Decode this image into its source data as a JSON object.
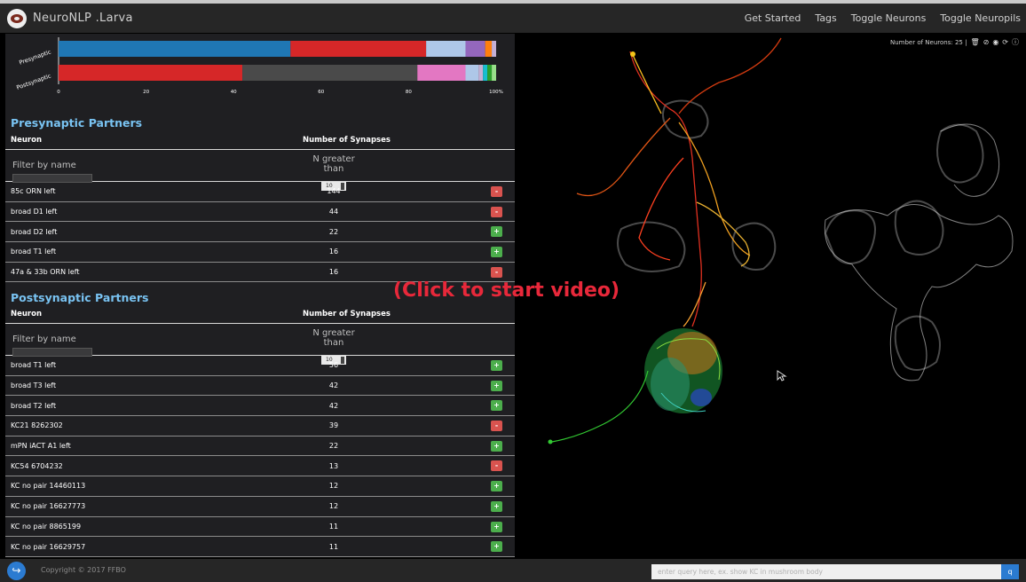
{
  "app": {
    "title": "NeuroNLP .Larva"
  },
  "nav": [
    {
      "label": "Get Started"
    },
    {
      "label": "Tags"
    },
    {
      "label": "Toggle Neurons"
    },
    {
      "label": "Toggle Neuropils"
    }
  ],
  "chart_data": {
    "type": "bar",
    "orientation": "horizontal-stacked",
    "categories": [
      "Presynaptic",
      "Postsynaptic"
    ],
    "x_ticks": [
      "0",
      "20",
      "40",
      "60",
      "80",
      "100%"
    ],
    "xlim": [
      0,
      100
    ],
    "series": [
      {
        "category": "Presynaptic",
        "segments": [
          {
            "value": 53,
            "color": "#1f77b4"
          },
          {
            "value": 31,
            "color": "#d62728"
          },
          {
            "value": 9,
            "color": "#aec7e8"
          },
          {
            "value": 4.5,
            "color": "#9467bd"
          },
          {
            "value": 1.5,
            "color": "#ff7f0e"
          },
          {
            "value": 1,
            "color": "#c5b0d5"
          }
        ]
      },
      {
        "category": "Postsynaptic",
        "segments": [
          {
            "value": 42,
            "color": "#d62728"
          },
          {
            "value": 40,
            "color": "#4a4a4a"
          },
          {
            "value": 11,
            "color": "#e377c2"
          },
          {
            "value": 3,
            "color": "#aec7e8"
          },
          {
            "value": 1,
            "color": "#c5b0d5"
          },
          {
            "value": 1,
            "color": "#17becf"
          },
          {
            "value": 1,
            "color": "#2ca02c"
          },
          {
            "value": 1,
            "color": "#98df8a"
          }
        ]
      }
    ]
  },
  "presynaptic": {
    "title": "Presynaptic Partners",
    "col_neuron": "Neuron",
    "col_synapses": "Number of Synapses",
    "filter_placeholder": "Filter by name",
    "n_greater_label": "N greater than",
    "n_greater_value": "10",
    "rows": [
      {
        "name": "85c ORN left",
        "count": "144",
        "action": "-"
      },
      {
        "name": "broad D1 left",
        "count": "44",
        "action": "-"
      },
      {
        "name": "broad D2 left",
        "count": "22",
        "action": "+"
      },
      {
        "name": "broad T1 left",
        "count": "16",
        "action": "+"
      },
      {
        "name": "47a & 33b ORN left",
        "count": "16",
        "action": "-"
      }
    ]
  },
  "postsynaptic": {
    "title": "Postsynaptic Partners",
    "col_neuron": "Neuron",
    "col_synapses": "Number of Synapses",
    "filter_placeholder": "Filter by name",
    "n_greater_label": "N greater than",
    "n_greater_value": "10",
    "rows": [
      {
        "name": "broad T1 left",
        "count": "56",
        "action": "+"
      },
      {
        "name": "broad T3 left",
        "count": "42",
        "action": "+"
      },
      {
        "name": "broad T2 left",
        "count": "42",
        "action": "+"
      },
      {
        "name": "KC21 8262302",
        "count": "39",
        "action": "-"
      },
      {
        "name": "mPN iACT A1 left",
        "count": "22",
        "action": "+"
      },
      {
        "name": "KC54 6704232",
        "count": "13",
        "action": "-"
      },
      {
        "name": "KC no pair 14460113",
        "count": "12",
        "action": "+"
      },
      {
        "name": "KC no pair 16627773",
        "count": "12",
        "action": "+"
      },
      {
        "name": "KC no pair 8865199",
        "count": "11",
        "action": "+"
      },
      {
        "name": "KC no pair 16629757",
        "count": "11",
        "action": "+"
      }
    ]
  },
  "viewer": {
    "neuron_count_label": "Number of Neurons: 25 |",
    "icons": [
      "trash-icon",
      "eye-slash-icon",
      "eye-icon",
      "refresh-icon",
      "info-icon"
    ]
  },
  "overlay": {
    "text": "(Click to start video)"
  },
  "footer": {
    "copyright": "Copyright © 2017 FFBO",
    "query_placeholder": "enter query here, ex. show KC in mushroom body",
    "query_button": "q"
  }
}
